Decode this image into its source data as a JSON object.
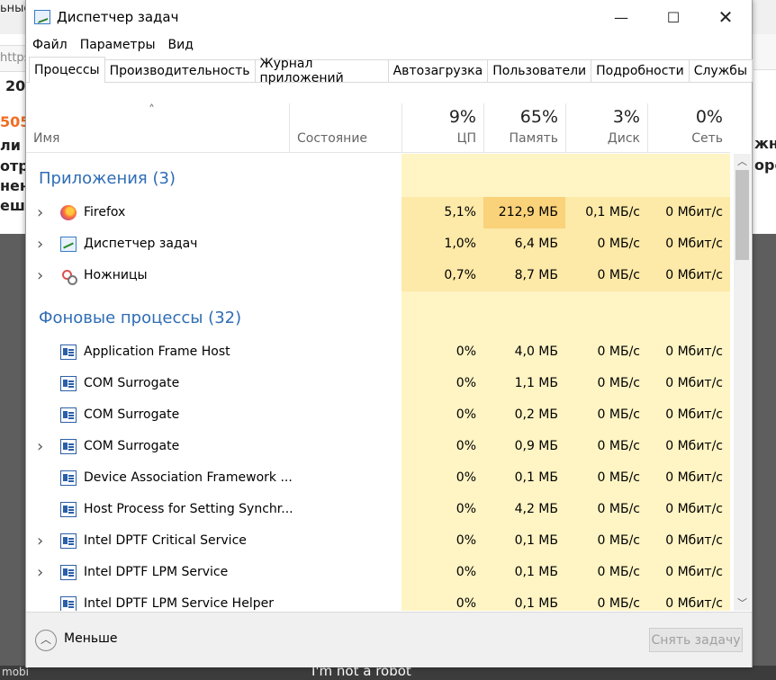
{
  "window": {
    "title": "Диспетчер задач"
  },
  "controls": {
    "minimize": "—",
    "maximize": "☐",
    "close": "✕"
  },
  "menu": [
    "Файл",
    "Параметры",
    "Вид"
  ],
  "tabs": [
    "Процессы",
    "Производительность",
    "Журнал приложений",
    "Автозагрузка",
    "Пользователи",
    "Подробности",
    "Службы"
  ],
  "active_tab": "Процессы",
  "columns": {
    "name": "Имя",
    "status": "Состояние",
    "cpu": {
      "percent": "9%",
      "label": "ЦП"
    },
    "memory": {
      "percent": "65%",
      "label": "Память"
    },
    "disk": {
      "percent": "3%",
      "label": "Диск"
    },
    "network": {
      "percent": "0%",
      "label": "Сеть"
    }
  },
  "groups": {
    "apps": "Приложения (3)",
    "background": "Фоновые процессы (32)"
  },
  "apps": [
    {
      "name": "Firefox",
      "icon": "firefox-icon",
      "cpu": "5,1%",
      "mem": "212,9 МБ",
      "disk": "0,1 МБ/с",
      "net": "0 Мбит/с"
    },
    {
      "name": "Диспетчер задач",
      "icon": "task-manager-icon",
      "cpu": "1,0%",
      "mem": "6,4 МБ",
      "disk": "0 МБ/с",
      "net": "0 Мбит/с"
    },
    {
      "name": "Ножницы",
      "icon": "scissors-icon",
      "cpu": "0,7%",
      "mem": "8,7 МБ",
      "disk": "0 МБ/с",
      "net": "0 Мбит/с"
    }
  ],
  "background": [
    {
      "name": "Application Frame Host",
      "cpu": "0%",
      "mem": "4,0 МБ",
      "disk": "0 МБ/с",
      "net": "0 Мбит/с"
    },
    {
      "name": "COM Surrogate",
      "cpu": "0%",
      "mem": "1,1 МБ",
      "disk": "0 МБ/с",
      "net": "0 Мбит/с"
    },
    {
      "name": "COM Surrogate",
      "cpu": "0%",
      "mem": "0,2 МБ",
      "disk": "0 МБ/с",
      "net": "0 Мбит/с"
    },
    {
      "name": "COM Surrogate",
      "cpu": "0%",
      "mem": "0,9 МБ",
      "disk": "0 МБ/с",
      "net": "0 Мбит/с"
    },
    {
      "name": "Device Association Framework ...",
      "cpu": "0%",
      "mem": "0,1 МБ",
      "disk": "0 МБ/с",
      "net": "0 Мбит/с"
    },
    {
      "name": "Host Process for Setting Synchr...",
      "cpu": "0%",
      "mem": "4,2 МБ",
      "disk": "0 МБ/с",
      "net": "0 Мбит/с"
    },
    {
      "name": "Intel DPTF Critical Service",
      "cpu": "0%",
      "mem": "0,1 МБ",
      "disk": "0 МБ/с",
      "net": "0 Мбит/с"
    },
    {
      "name": "Intel DPTF LPM Service",
      "cpu": "0%",
      "mem": "0,1 МБ",
      "disk": "0 МБ/с",
      "net": "0 Мбит/с"
    },
    {
      "name": "Intel DPTF LPM Service Helper",
      "cpu": "0%",
      "mem": "0,1 МБ",
      "disk": "0 МБ/с",
      "net": "0 Мбит/с"
    }
  ],
  "footer": {
    "less": "Меньше",
    "end_task": "Снять задачу"
  },
  "background_page": {
    "frag1": "ьные",
    "frag2": "https",
    "frag3": "20",
    "frag4": "505",
    "frag5": "ли",
    "frag6": "отр",
    "frag7": "нен",
    "frag8": "ешь",
    "frag9": "жн",
    "frag10": "оро",
    "frag11": "mobi",
    "frag12": "I'm not a robot"
  },
  "colors": {
    "group_title": "#2f6db5",
    "heat_light": "#fff4c4",
    "heat_medium": "#fde9a8",
    "heat_strong": "#f9d27a"
  }
}
